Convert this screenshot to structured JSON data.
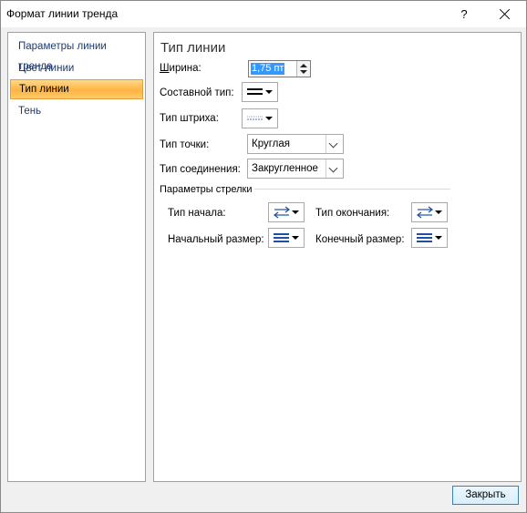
{
  "window": {
    "title": "Формат линии тренда",
    "help": "?",
    "close_button": "Закрыть"
  },
  "nav": {
    "items": [
      {
        "label": "Параметры линии тренда",
        "selected": false
      },
      {
        "label": "Цвет линии",
        "selected": false
      },
      {
        "label": "Тип линии",
        "selected": true
      },
      {
        "label": "Тень",
        "selected": false
      }
    ]
  },
  "panel": {
    "title": "Тип линии",
    "width": {
      "label_pre": "Ш",
      "label_u": "",
      "label_post": "ирина:",
      "value": "1,75 пт"
    },
    "compound_label": "Составной тип:",
    "dash_label": "Тип штриха:",
    "cap_label": "Тип точки:",
    "cap_value": "Круглая",
    "join_label": "Тип соединения:",
    "join_value": "Закругленное",
    "arrow_section": "Параметры стрелки",
    "begin_type_label": "Тип начала:",
    "end_type_label": "Тип окончания:",
    "begin_size_label": "Начальный размер:",
    "end_size_label": "Конечный размер:"
  },
  "colors": {
    "selected_nav": "#ffb341",
    "nav_text": "#1e3a6e",
    "glyph_blue": "#1f4fa3"
  }
}
